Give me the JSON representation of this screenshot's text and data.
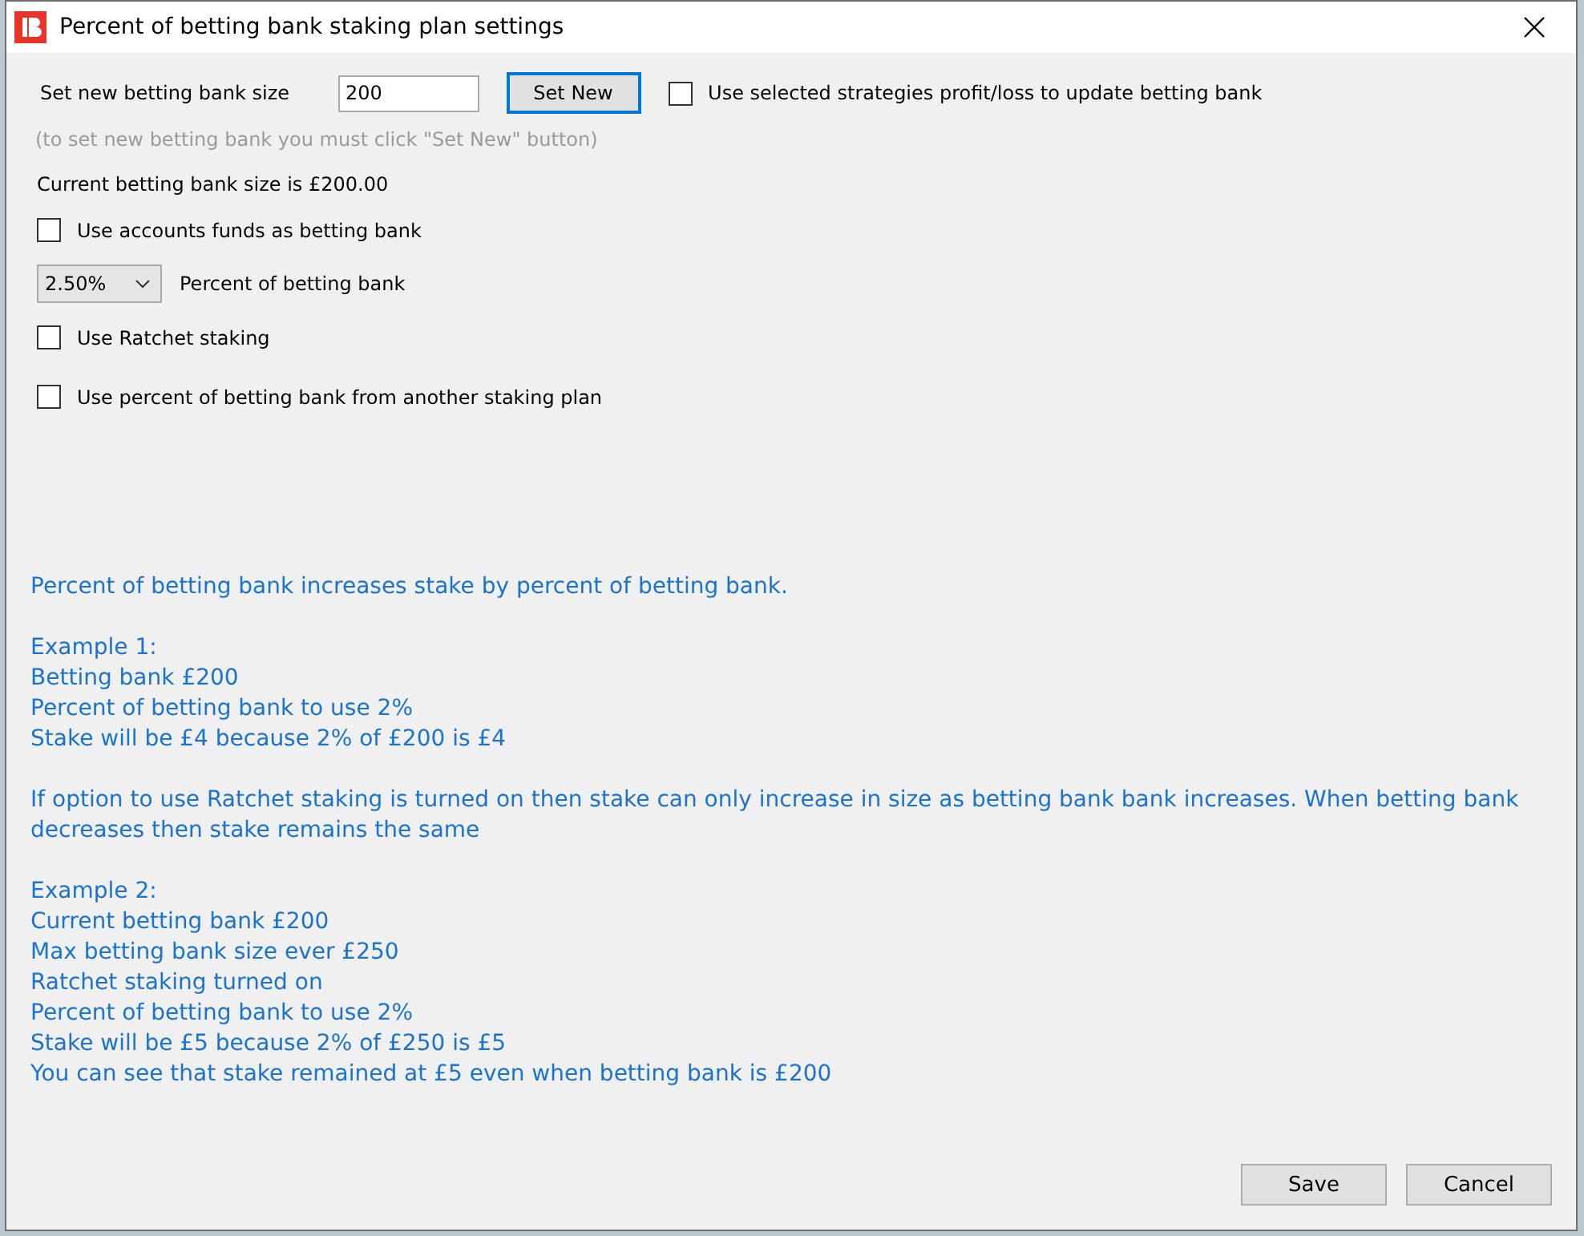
{
  "window": {
    "title": "Percent of betting bank staking plan settings"
  },
  "bank_size": {
    "label": "Set new betting bank size",
    "value": "200",
    "button": "Set New"
  },
  "use_strategies": {
    "label": "Use selected strategies profit/loss to update betting bank",
    "checked": false
  },
  "hint": "(to set new betting bank you must click \"Set New\" button)",
  "current": "Current betting bank size is £200.00",
  "use_account_funds": {
    "label": "Use accounts funds as betting bank",
    "checked": false
  },
  "percent": {
    "value": "2.50%",
    "label": "Percent of betting bank"
  },
  "use_ratchet": {
    "label": "Use Ratchet staking",
    "checked": false
  },
  "use_other_plan": {
    "label": "Use percent of betting bank from another staking plan",
    "checked": false
  },
  "help_paragraphs": [
    [
      "Percent of betting bank increases stake by percent of betting bank."
    ],
    [
      "Example 1:",
      "Betting bank £200",
      "Percent of betting bank to use 2%",
      "Stake will be £4 because 2% of £200 is £4"
    ],
    [
      "If option to use Ratchet staking is turned on then stake can only increase in size as betting bank bank increases. When betting bank decreases then stake remains the same"
    ],
    [
      "Example 2:",
      "Current betting bank £200",
      "Max betting bank size ever £250",
      "Ratchet staking turned on",
      "Percent of betting bank to use 2%",
      "Stake will be £5 because 2% of £250 is £5",
      "You can see that stake remained at £5 even when betting bank is £200"
    ]
  ],
  "buttons": [
    "Save",
    "Cancel"
  ]
}
